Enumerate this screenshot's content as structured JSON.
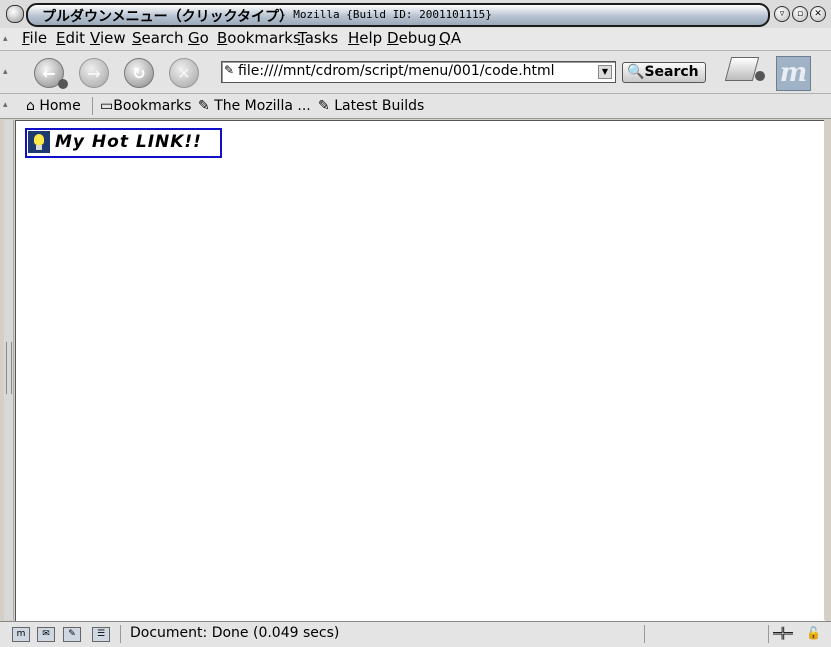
{
  "window": {
    "title": "プルダウンメニュー（クリックタイプ）",
    "title_suffix": "- Mozilla {Build ID: 2001101115}"
  },
  "menubar": {
    "items": [
      "File",
      "Edit",
      "View",
      "Search",
      "Go",
      "Bookmarks",
      "Tasks",
      "Help",
      "Debug",
      "QA"
    ]
  },
  "navbar": {
    "url": "file:////mnt/cdrom/script/menu/001/code.html",
    "search_label": "Search"
  },
  "personal_toolbar": {
    "home": "Home",
    "bookmarks": "Bookmarks",
    "mozilla": "The Mozilla ...",
    "builds": "Latest Builds"
  },
  "content": {
    "link_text": "My Hot LINK!!"
  },
  "statusbar": {
    "text": "Document: Done (0.049 secs)"
  },
  "colors": {
    "link_border": "#1010c8",
    "logo_bg": "#9fb2c6"
  }
}
